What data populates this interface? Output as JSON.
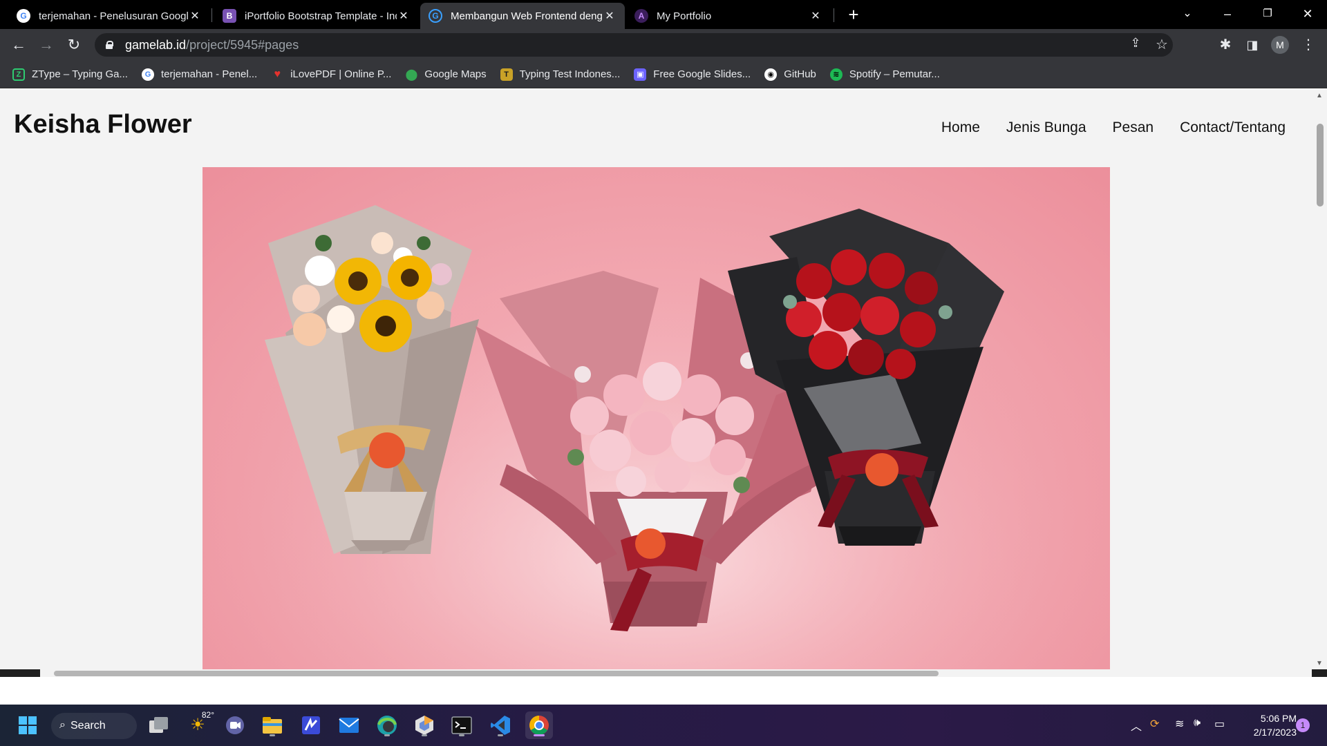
{
  "browser": {
    "tabs": [
      {
        "title": "terjemahan - Penelusuran Google",
        "favicon": "google-icon",
        "active": false
      },
      {
        "title": "iPortfolio Bootstrap Template - Index",
        "favicon": "bootstrap-icon",
        "active": false
      },
      {
        "title": "Membangun Web Frontend dengan",
        "favicon": "gamelab-icon",
        "active": true
      },
      {
        "title": "My Portfolio",
        "favicon": "portfolio-icon",
        "active": false
      }
    ],
    "address": {
      "host": "gamelab.id",
      "path": "/project/5945#pages"
    },
    "profile_initial": "M",
    "bookmarks": [
      {
        "label": "ZType – Typing Ga...",
        "icon": "ztype-icon",
        "color": "#2ecc71"
      },
      {
        "label": "terjemahan - Penel...",
        "icon": "google-icon",
        "color": "#4285f4"
      },
      {
        "label": "iLovePDF | Online P...",
        "icon": "heart-icon",
        "color": "#e5322d"
      },
      {
        "label": "Google Maps",
        "icon": "maps-pin-icon",
        "color": "#34a853"
      },
      {
        "label": "Typing Test Indones...",
        "icon": "typing-test-icon",
        "color": "#c9a227"
      },
      {
        "label": "Free Google Slides...",
        "icon": "slides-icon",
        "color": "#6c63ff"
      },
      {
        "label": "GitHub",
        "icon": "github-icon",
        "color": "#ffffff"
      },
      {
        "label": "Spotify – Pemutar...",
        "icon": "spotify-icon",
        "color": "#1db954"
      }
    ]
  },
  "site": {
    "brand": "Keisha Flower",
    "nav": [
      "Home",
      "Jenis Bunga",
      "Pesan",
      "Contact/Tentang"
    ],
    "hero_alt": "three bouquets on pink background",
    "bouquets": [
      {
        "name": "sunflower-bouquet",
        "wrap": "#b7aaa5",
        "flowers": [
          "#f2b705",
          "#f6c9a8",
          "#ffffff",
          "#f3d4d9"
        ]
      },
      {
        "name": "pink-rose-bouquet",
        "wrap": "#c56d7b",
        "flowers": [
          "#f6c2cb",
          "#f7d3da",
          "#ffffff"
        ]
      },
      {
        "name": "red-rose-bouquet",
        "wrap": "#2a2a2d",
        "flowers": [
          "#b5121b",
          "#d01f2a",
          "#9c0f18"
        ]
      }
    ]
  },
  "taskbar": {
    "search_label": "Search",
    "weather": "82°",
    "time": "5:06 PM",
    "date": "2/17/2023",
    "notifications": "1"
  }
}
